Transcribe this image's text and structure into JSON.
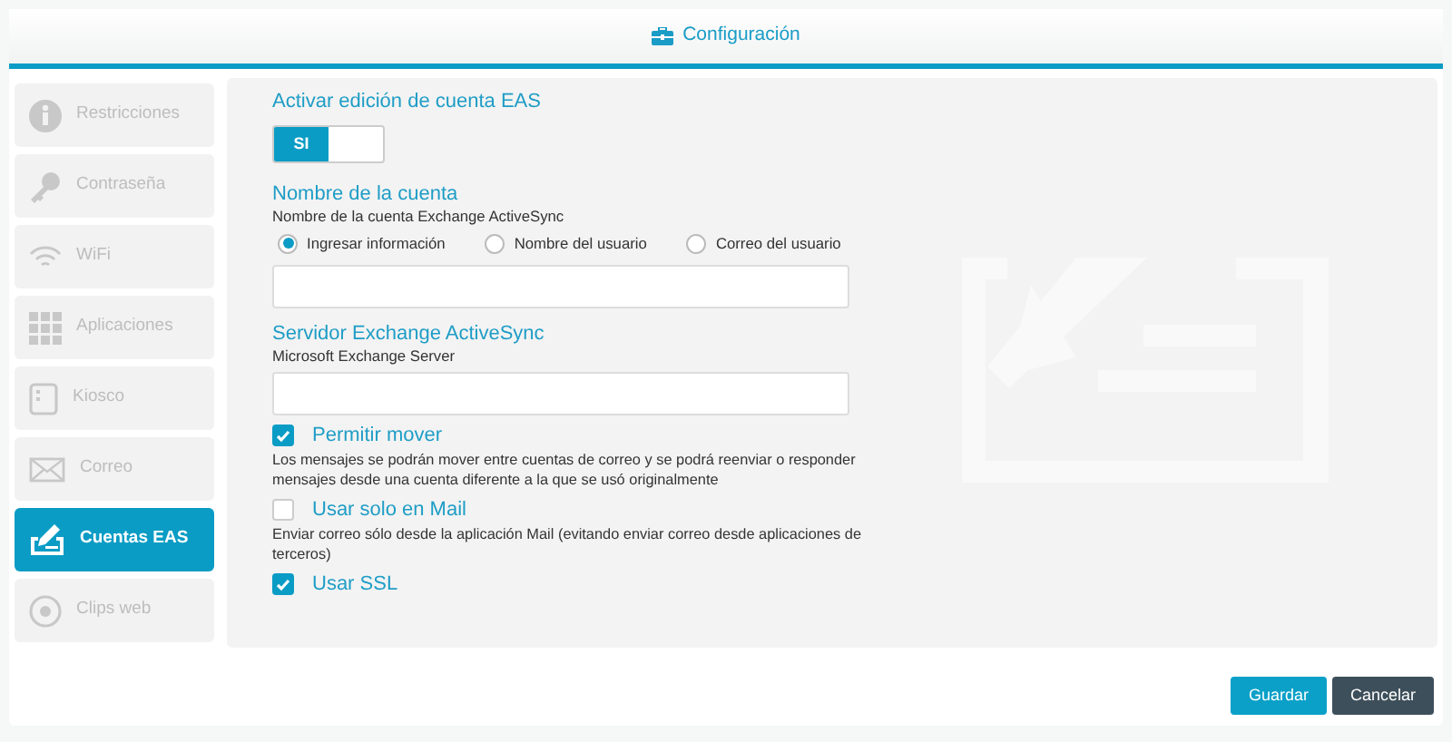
{
  "header": {
    "title": "Configuración"
  },
  "sidebar": {
    "items": [
      {
        "label": "Restricciones",
        "selected": false
      },
      {
        "label": "Contraseña",
        "selected": false
      },
      {
        "label": "WiFi",
        "selected": false
      },
      {
        "label": "Aplicaciones",
        "selected": false
      },
      {
        "label": "Kiosco",
        "selected": false
      },
      {
        "label": "Correo",
        "selected": false
      },
      {
        "label": "Cuentas EAS",
        "selected": true
      },
      {
        "label": "Clips web",
        "selected": false
      }
    ]
  },
  "form": {
    "enable": {
      "label": "Activar edición de cuenta EAS",
      "toggle_label": "SI",
      "on": true
    },
    "account_name": {
      "label": "Nombre de la cuenta",
      "hint": "Nombre de la cuenta Exchange ActiveSync",
      "options": [
        {
          "label": "Ingresar información",
          "selected": true
        },
        {
          "label": "Nombre del usuario",
          "selected": false
        },
        {
          "label": "Correo del usuario",
          "selected": false
        }
      ]
    },
    "server": {
      "label": "Servidor Exchange ActiveSync",
      "hint": "Microsoft Exchange Server"
    },
    "settings": [
      {
        "label": "Permitir mover",
        "checked": true,
        "description": "Los mensajes se podrán mover entre cuentas de correo y se podrá reenviar o responder mensajes desde una cuenta diferente a la que se usó originalmente"
      },
      {
        "label": "Usar solo en Mail",
        "checked": false,
        "description": "Enviar correo sólo desde la aplicación Mail (evitando enviar correo desde aplicaciones de terceros)"
      },
      {
        "label": "Usar SSL",
        "checked": true
      }
    ]
  },
  "buttons": [
    {
      "label": "Guardar",
      "kind": "primary"
    },
    {
      "label": "Cancelar",
      "kind": "secondary"
    }
  ]
}
